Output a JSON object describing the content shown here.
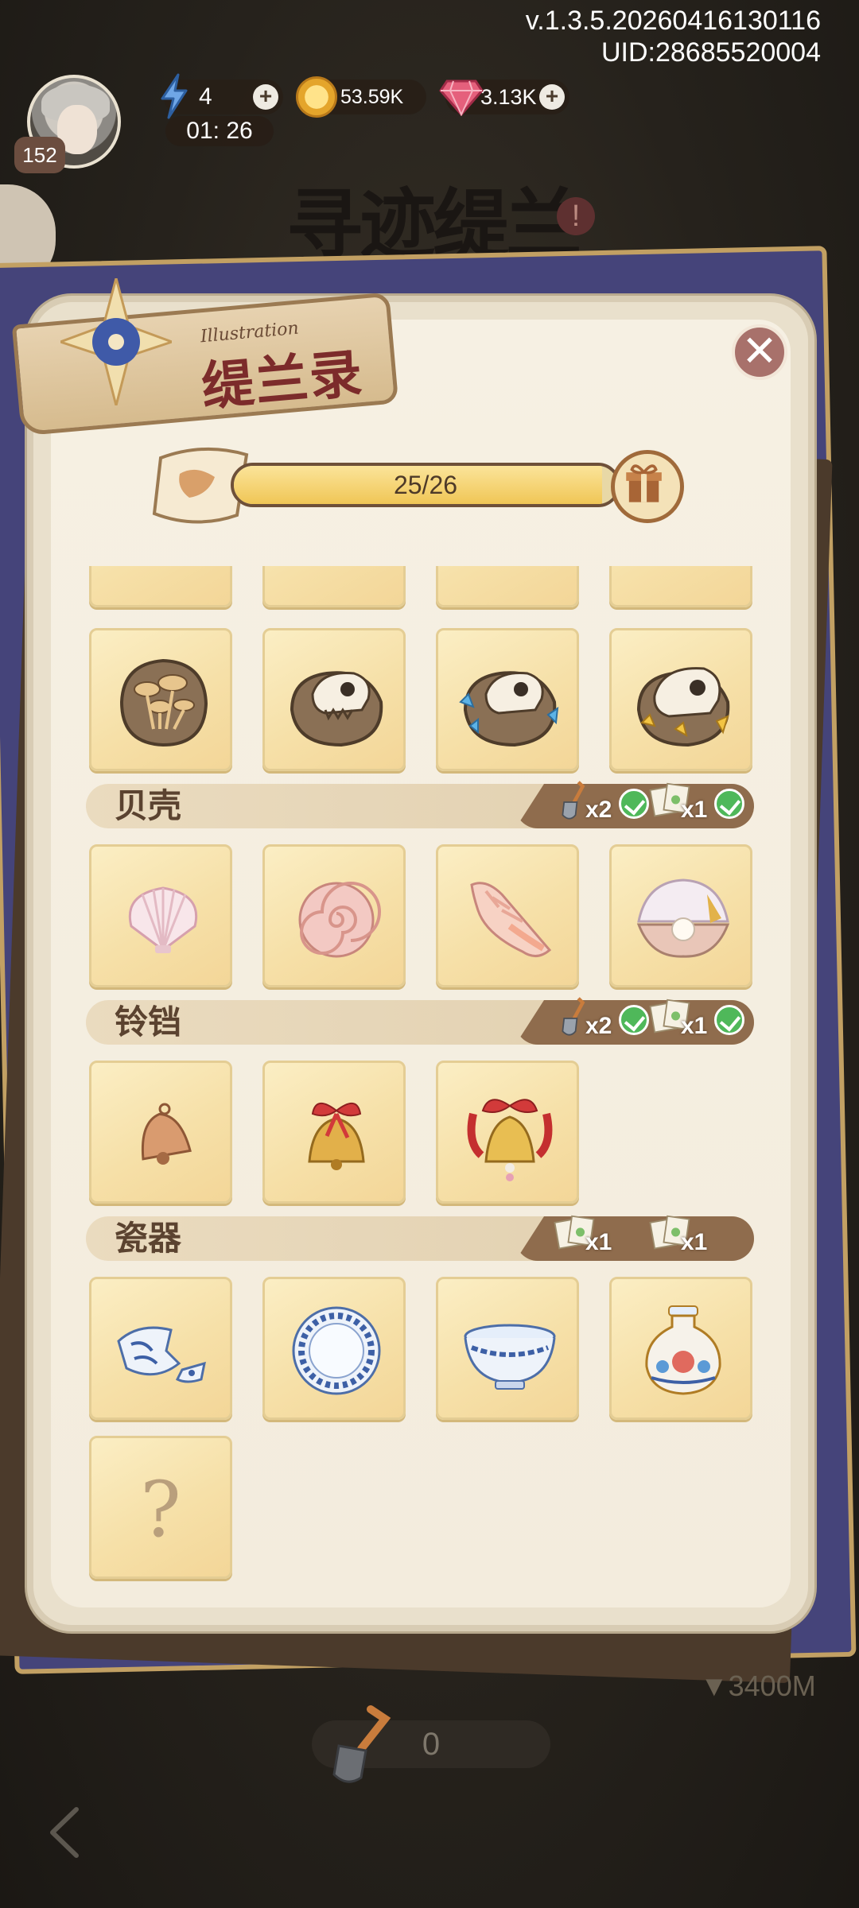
{
  "hud": {
    "version": "v.1.3.5.20260416130116",
    "uid": "UID:28685520004",
    "level": "152",
    "energy": "4",
    "energy_timer": "01: 26",
    "coins": "53.59K",
    "gems": "3.13K",
    "plus_label": "+"
  },
  "background": {
    "title": "寻迹缇兰",
    "warning": "!"
  },
  "panel": {
    "title_sub": "Illustration",
    "title": "缇兰录",
    "close_label": "✕",
    "progress_text": "25/26",
    "progress_fraction": 0.96
  },
  "categories": [
    {
      "name": "贝壳",
      "rewards": [
        {
          "icon": "shovel-icon",
          "amount": "x2",
          "claimed": true
        },
        {
          "icon": "card-pack-icon",
          "amount": "x1",
          "claimed": true
        }
      ]
    },
    {
      "name": "铃铛",
      "rewards": [
        {
          "icon": "shovel-icon",
          "amount": "x2",
          "claimed": true
        },
        {
          "icon": "card-pack-icon",
          "amount": "x1",
          "claimed": true
        }
      ]
    },
    {
      "name": "瓷器",
      "rewards": [
        {
          "icon": "card-pack-icon",
          "amount": "x1",
          "claimed": false
        },
        {
          "icon": "card-pack-icon",
          "amount": "x1",
          "claimed": false
        }
      ]
    }
  ],
  "items": {
    "fossils": [
      "mushroom-fossil",
      "skull-fossil",
      "crystal-skull-fossil",
      "gold-skull-fossil"
    ],
    "shells": [
      "scallop-shell",
      "snail-shell",
      "conch-shell",
      "pearl-clam"
    ],
    "bells": [
      "copper-bell",
      "red-ribbon-bell",
      "gold-ribbon-bell"
    ],
    "porcelain": [
      "broken-porcelain",
      "blue-white-plate",
      "blue-white-bowl",
      "floral-vase"
    ],
    "unknown_label": "?"
  },
  "footer": {
    "depth": "▼3400M",
    "shovel_count": "0"
  }
}
